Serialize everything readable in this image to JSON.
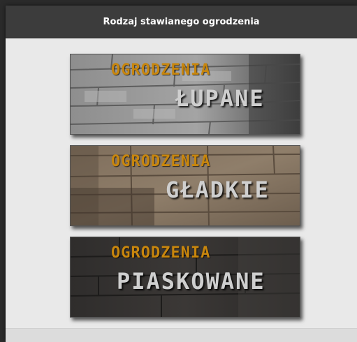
{
  "dialog": {
    "title": "Rodzaj stawianego ogrodzenia"
  },
  "options": [
    {
      "line1": "OGRODZENIA",
      "line2": "ŁUPANE",
      "texture": "split-stone-wall"
    },
    {
      "line1": "OGRODZENIA",
      "line2": "GŁADKIE",
      "texture": "smooth-beige-block-wall"
    },
    {
      "line1": "OGRODZENIA",
      "line2": "PIASKOWANE",
      "texture": "dark-sandblasted-wall"
    }
  ],
  "colors": {
    "header_bg": "#3c3c3c",
    "body_bg": "#e9e9e9",
    "accent_orange": "#c8860d",
    "label_gray": "#cfcfcf"
  }
}
